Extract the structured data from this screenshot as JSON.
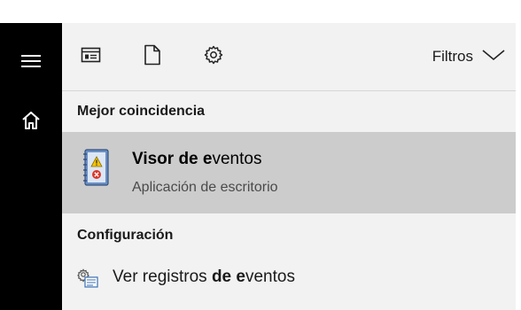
{
  "sidebar": {
    "menu_icon": "hamburger-icon",
    "home_icon": "home-icon"
  },
  "toolbar": {
    "icons": [
      "apps-icon",
      "document-icon",
      "settings-icon"
    ],
    "filters_label": "Filtros"
  },
  "best_match": {
    "header": "Mejor coincidencia",
    "title_plain": "Visor de e",
    "title_bold": "ventos",
    "subtitle": "Aplicación de escritorio",
    "icon": "event-viewer-icon"
  },
  "settings": {
    "header": "Configuración",
    "items": [
      {
        "text_before": "Ver registros ",
        "text_bold": "de e",
        "text_after": "ventos",
        "icon": "settings-log-icon"
      }
    ]
  },
  "colors": {
    "sidebar": "#000000",
    "panel": "#f2f2f2",
    "selected": "#cccccc"
  }
}
